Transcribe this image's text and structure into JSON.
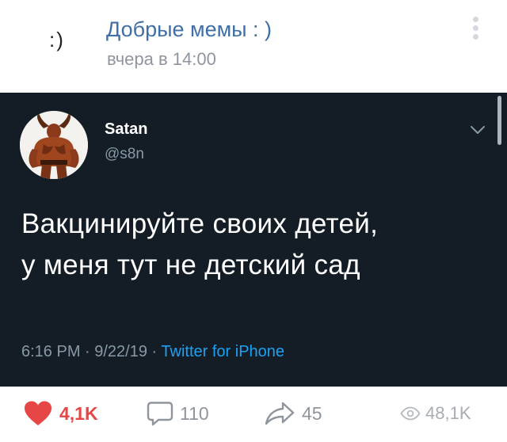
{
  "post": {
    "group_avatar_text": ":)",
    "group_name": "Добрые мемы : )",
    "time": "вчера в 14:00"
  },
  "tweet": {
    "author_name": "Satan",
    "handle": "@s8n",
    "text_line1": "Вакцинируйте своих детей,",
    "text_line2": "у меня тут не детский сад",
    "meta_datetime": "6:16 PM · 9/22/19 · ",
    "meta_source": "Twitter for iPhone"
  },
  "footer": {
    "likes": "4,1K",
    "comments": "110",
    "shares": "45",
    "views": "48,1K"
  },
  "colors": {
    "tweet_background": "#141d26",
    "vk_link_blue": "#3f6fa6",
    "like_red": "#e64646",
    "twitter_blue": "#1da1f2"
  }
}
